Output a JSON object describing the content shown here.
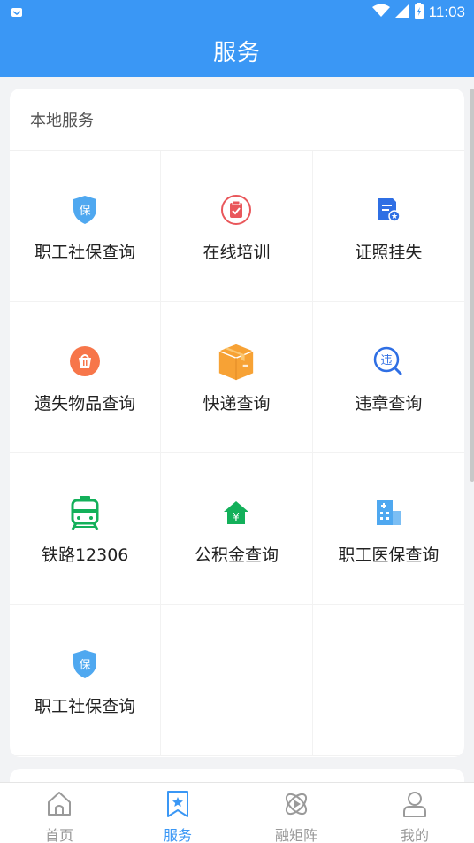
{
  "status_bar": {
    "time": "11:03"
  },
  "header": {
    "title": "服务"
  },
  "section": {
    "title": "本地服务"
  },
  "services": [
    {
      "label": "职工社保查询",
      "icon": "shield-bao-icon"
    },
    {
      "label": "在线培训",
      "icon": "clipboard-check-icon"
    },
    {
      "label": "证照挂失",
      "icon": "document-star-icon"
    },
    {
      "label": "遗失物品查询",
      "icon": "basket-icon"
    },
    {
      "label": "快递查询",
      "icon": "package-box-icon"
    },
    {
      "label": "违章查询",
      "icon": "violation-search-icon"
    },
    {
      "label": "铁路12306",
      "icon": "train-icon"
    },
    {
      "label": "公积金查询",
      "icon": "house-yuan-icon"
    },
    {
      "label": "职工医保查询",
      "icon": "hospital-building-icon"
    },
    {
      "label": "职工社保查询",
      "icon": "shield-bao-icon"
    }
  ],
  "tabs": [
    {
      "label": "首页",
      "icon": "home-icon",
      "active": false
    },
    {
      "label": "服务",
      "icon": "bookmark-star-icon",
      "active": true
    },
    {
      "label": "融矩阵",
      "icon": "atom-play-icon",
      "active": false
    },
    {
      "label": "我的",
      "icon": "user-icon",
      "active": false
    }
  ],
  "colors": {
    "primary": "#3a97f5",
    "tab_inactive": "#999999"
  },
  "icon_glyphs": {
    "bao": "保",
    "wei": "违",
    "yuan": "¥"
  }
}
